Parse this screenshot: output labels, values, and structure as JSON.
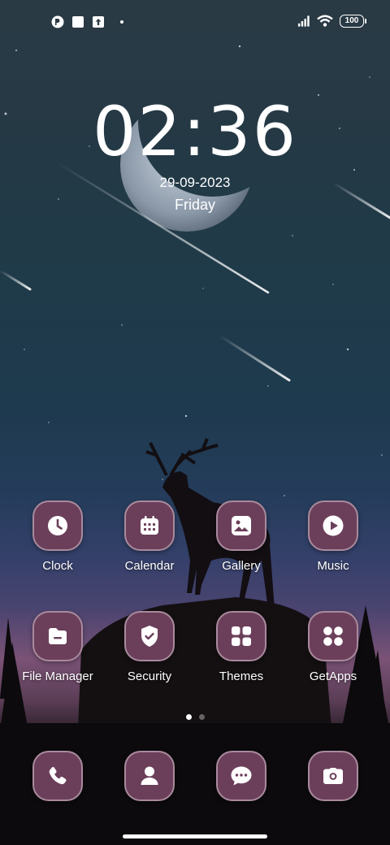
{
  "status_bar": {
    "left_icons": [
      "app-notification-icon",
      "square-notification-icon",
      "upload-notification-icon"
    ],
    "signal_icon": "cellular-signal-icon",
    "wifi_icon": "wifi-icon",
    "battery_level": "100"
  },
  "clock_widget": {
    "time": "02:36",
    "date": "29-09-2023",
    "day": "Friday"
  },
  "apps": {
    "row1": [
      {
        "label": "Clock",
        "icon": "clock-icon"
      },
      {
        "label": "Calendar",
        "icon": "calendar-icon"
      },
      {
        "label": "Gallery",
        "icon": "gallery-icon"
      },
      {
        "label": "Music",
        "icon": "play-icon"
      }
    ],
    "row2": [
      {
        "label": "File Manager",
        "icon": "folder-icon"
      },
      {
        "label": "Security",
        "icon": "shield-icon"
      },
      {
        "label": "Themes",
        "icon": "themes-grid-icon"
      },
      {
        "label": "GetApps",
        "icon": "getapps-icon"
      }
    ]
  },
  "pager": {
    "pages": 2,
    "active": 1
  },
  "dock": [
    {
      "icon": "phone-icon"
    },
    {
      "icon": "contacts-icon"
    },
    {
      "icon": "messages-icon"
    },
    {
      "icon": "camera-icon"
    }
  ],
  "colors": {
    "tile_fill": "#6b3f5a",
    "tile_border": "#a98a9d",
    "text": "#ffffff"
  }
}
